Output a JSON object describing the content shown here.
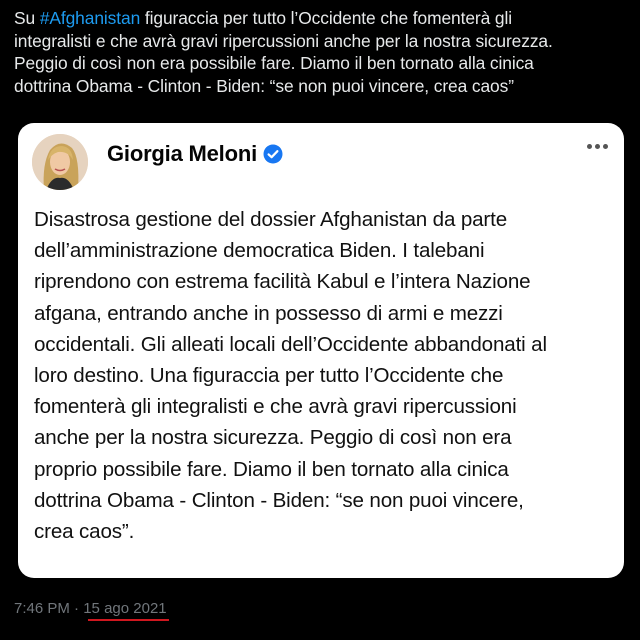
{
  "tweet": {
    "hashtag": "#Afghanistan",
    "line1_rest": " figuraccia per tutto l’Occidente che fomenterà gli",
    "line2": "integralisti e che avrà gravi ripercussioni anche per la nostra sicurezza.",
    "line3": "Peggio di così non era possibile fare. Diamo il ben tornato alla cinica",
    "line4": "dottrina Obama - Clinton - Biden: “se non puoi vincere, crea caos”"
  },
  "embedded_post": {
    "author": "Giorgia Meloni",
    "verified_icon": "verified-badge-icon",
    "more_icon": "more-options-icon",
    "body_lines": [
      "Disastrosa gestione del dossier Afghanistan da parte",
      "dell’amministrazione democratica Biden. I talebani",
      "riprendono con estrema facilità Kabul e l’intera Nazione",
      "afgana, entrando anche in possesso di armi e mezzi",
      "occidentali. Gli alleati locali dell’Occidente abbandonati al",
      "loro destino. Una figuraccia per tutto l’Occidente che",
      "fomenterà gli integralisti e che avrà gravi ripercussioni",
      "anche per la nostra sicurezza. Peggio di così non era",
      "proprio possibile fare. Diamo il ben tornato alla cinica",
      "dottrina Obama - Clinton - Biden: “se non puoi vincere,",
      "crea caos”."
    ]
  },
  "meta": {
    "time": "7:46 PM",
    "separator": " · ",
    "date": "15 ago 2021"
  },
  "colors": {
    "background": "#000000",
    "hashtag": "#1d9bf0",
    "verified": "#1877f2",
    "underline": "#d0171f"
  }
}
